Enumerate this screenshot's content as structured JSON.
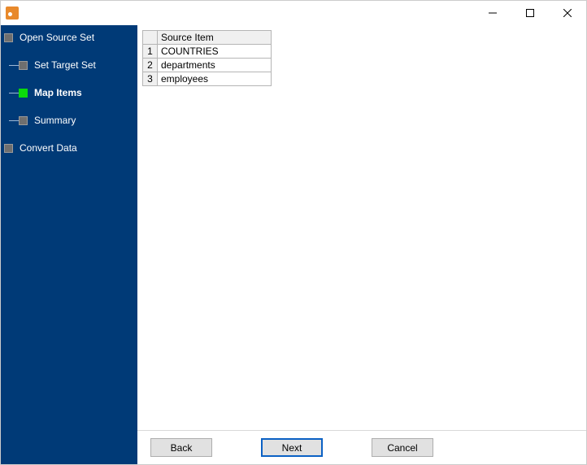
{
  "window": {
    "title": ""
  },
  "wizard": {
    "steps": [
      {
        "label": "Open Source Set",
        "active": false,
        "level": 0
      },
      {
        "label": "Set Target Set",
        "active": false,
        "level": 1
      },
      {
        "label": "Map Items",
        "active": true,
        "level": 1
      },
      {
        "label": "Summary",
        "active": false,
        "level": 1
      },
      {
        "label": "Convert Data",
        "active": false,
        "level": 0
      }
    ]
  },
  "grid": {
    "columns": [
      "Source Item"
    ],
    "rows": [
      {
        "n": "1",
        "source_item": "COUNTRIES"
      },
      {
        "n": "2",
        "source_item": "departments"
      },
      {
        "n": "3",
        "source_item": "employees"
      }
    ]
  },
  "buttons": {
    "back": "Back",
    "next": "Next",
    "cancel": "Cancel"
  }
}
